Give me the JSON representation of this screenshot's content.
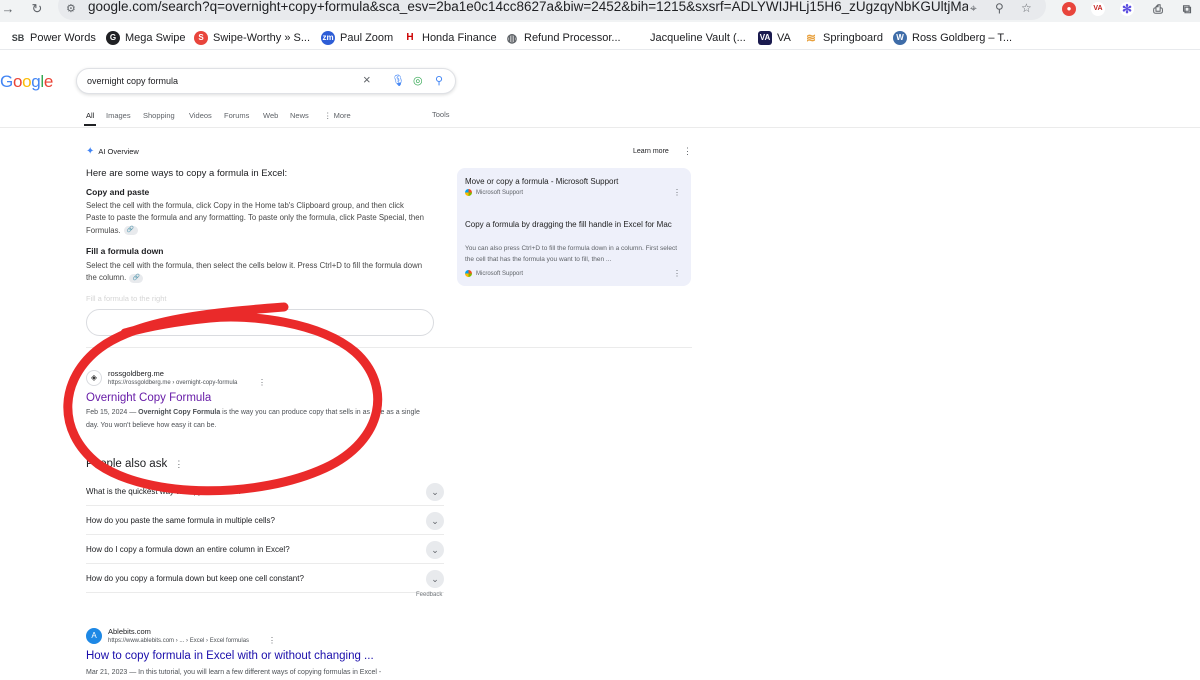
{
  "browser": {
    "url": "google.com/search?q=overnight+copy+formula&sca_esv=2ba1e0c14cc8627a&biw=2452&bih=1215&sxsrf=ADLYWIJHLj15H6_zUgzqyNbKGUltjMaKow%3A17...",
    "extensions": [
      {
        "name": "extension-red-icon",
        "color": "#e8453c",
        "glyph": ""
      },
      {
        "name": "extension-va-icon",
        "color": "#ffffff",
        "glyph": "VA"
      },
      {
        "name": "extension-purple-gear-icon",
        "color": "#5b4de0",
        "glyph": "✻"
      },
      {
        "name": "printer-icon",
        "color": "#5f6368",
        "glyph": "⎙"
      },
      {
        "name": "extensions-puzzle-icon",
        "color": "#5f6368",
        "glyph": "⧉"
      }
    ]
  },
  "bookmarks": [
    {
      "label": "Power Words",
      "icon": "SB",
      "color": "#3c4043"
    },
    {
      "label": "Mega Swipe",
      "icon": "G",
      "color": "#202124"
    },
    {
      "label": "Swipe-Worthy » S...",
      "icon": "S",
      "color": "#e8453c"
    },
    {
      "label": "Paul Zoom",
      "icon": "zm",
      "color": "#2d5dd6"
    },
    {
      "label": "Honda Finance",
      "icon": "H",
      "color": "#cc0000"
    },
    {
      "label": "Refund Processor...",
      "icon": "◍",
      "color": "#5f6368"
    },
    {
      "label": "Jacqueline Vault (...",
      "icon": "",
      "color": "#ffffff"
    },
    {
      "label": "VA",
      "icon": "VA",
      "color": "#1a1a4e"
    },
    {
      "label": "Springboard",
      "icon": "≋",
      "color": "#e8a03c"
    },
    {
      "label": "Ross Goldberg – T...",
      "icon": "W",
      "color": "#3e6ca8"
    }
  ],
  "search": {
    "query": "overnight copy formula",
    "tabs": [
      "All",
      "Images",
      "Shopping",
      "Videos",
      "Forums",
      "Web",
      "News",
      "⋮ More"
    ],
    "tools": "Tools"
  },
  "ai_overview": {
    "label": "AI Overview",
    "learn_more": "Learn more",
    "intro": "Here are some ways to copy a formula in Excel:",
    "sections": [
      {
        "heading": "Copy and paste",
        "body": "Select the cell with the formula, click Copy in the Home tab's Clipboard group, and then click Paste to paste the formula and any formatting. To paste only the formula, click Paste Special, then Formulas."
      },
      {
        "heading": "Fill a formula down",
        "body": "Select the cell with the formula, then select the cells below it. Press Ctrl+D to fill the formula down the column."
      }
    ],
    "faded_line": "Fill a formula to the right",
    "sources": [
      {
        "title": "Move or copy a formula - Microsoft Support",
        "site": "Microsoft Support",
        "snippet": ""
      },
      {
        "title": "Copy a formula by dragging the fill handle in Excel for Mac",
        "site": "Microsoft Support",
        "snippet": "You can also press Ctrl+D to fill the formula down in a column. First select the cell that has the formula you want to fill, then ..."
      }
    ]
  },
  "results": [
    {
      "site": "rossgoldberg.me",
      "url": "https://rossgoldberg.me › overnight-copy-formula",
      "title": "Overnight Copy Formula",
      "date": "Feb 15, 2024 —",
      "bold": "Overnight Copy Formula",
      "snippet": "is the way you can produce copy that sells in as little as a single day. You won't believe how easy it can be.",
      "title_color": "#681da8"
    },
    {
      "site": "Ablebits.com",
      "url": "https://www.ablebits.com › ... › Excel › Excel formulas",
      "title": "How to copy formula in Excel with or without changing ...",
      "date": "Mar 21, 2023 —",
      "snippet": "In this tutorial, you will learn a few different ways of copying formulas in Excel -",
      "title_color": "#1a0dab"
    }
  ],
  "people_also_ask": {
    "heading": "People also ask",
    "questions": [
      "What is the quickest way to copy a formula?",
      "How do you paste the same formula in multiple cells?",
      "How do I copy a formula down an entire column in Excel?",
      "How do you copy a formula down but keep one cell constant?"
    ],
    "feedback": "Feedback"
  },
  "annotation": {
    "color": "#ea2a2a"
  }
}
